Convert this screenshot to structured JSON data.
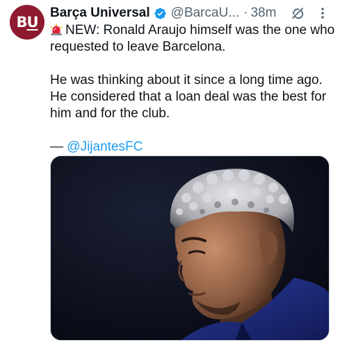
{
  "tweet": {
    "avatar_text_1": "B",
    "avatar_text_2": "U",
    "display_name": "Barça Universal",
    "handle": "@BarcaU...",
    "separator": "·",
    "timestamp": "38m",
    "line_1": "NEW: Ronald Araujo himself was the one who requested to leave Barcelona.",
    "line_2": "He was thinking about it since a long time ago. He considered that a loan deal was the best for him and for the club.",
    "attribution_prefix": "— ",
    "attribution_mention": "@JijantesFC"
  },
  "icons": {
    "avatar": "barca-universal-logo",
    "verified": "verified-badge-icon",
    "grok": "grok-icon",
    "more": "more-icon",
    "siren": "siren-icon"
  },
  "colors": {
    "avatar_bg": "#8e1a2f",
    "verified": "#1d9bf0",
    "link": "#1d9bf0",
    "muted": "#536471"
  }
}
